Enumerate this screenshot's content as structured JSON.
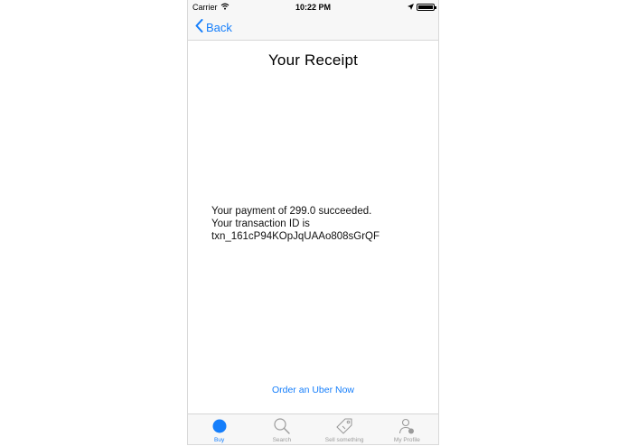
{
  "status_bar": {
    "carrier": "Carrier",
    "time": "10:22 PM"
  },
  "nav": {
    "back_label": "Back"
  },
  "receipt": {
    "title": "Your Receipt",
    "line1": "Your payment of 299.0 succeeded.",
    "line2": "Your transaction ID is",
    "line3": "txn_161cP94KOpJqUAAo808sGrQF"
  },
  "actions": {
    "uber_link": "Order an Uber Now"
  },
  "tabs": [
    {
      "label": "Buy",
      "icon": "circle-icon",
      "active": true
    },
    {
      "label": "Search",
      "icon": "search-icon",
      "active": false
    },
    {
      "label": "Sell something",
      "icon": "tag-icon",
      "active": false
    },
    {
      "label": "My Profile",
      "icon": "profile-icon",
      "active": false
    }
  ],
  "colors": {
    "accent": "#157efb",
    "inactive": "#9b9b9b",
    "bar_background": "#f7f7f7"
  }
}
